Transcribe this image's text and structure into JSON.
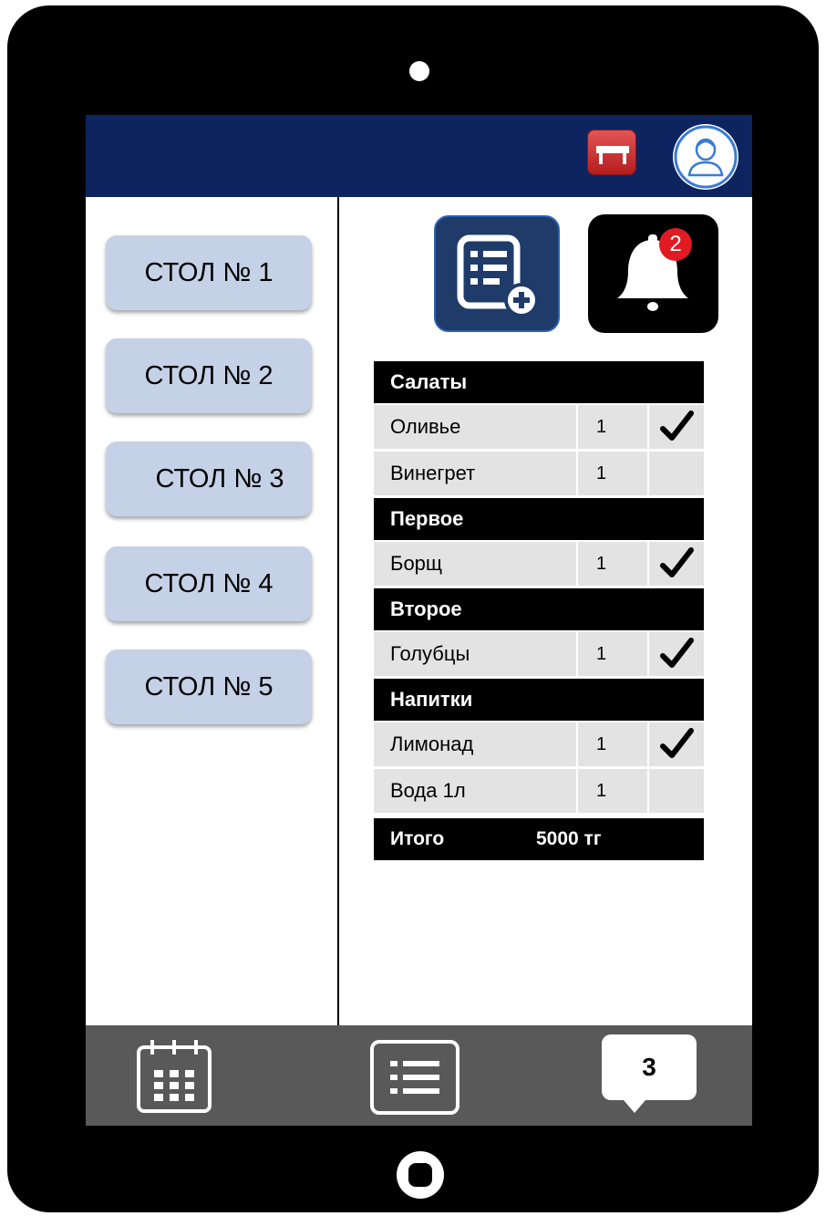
{
  "tables": [
    {
      "label": "СТОЛ № 1"
    },
    {
      "label": "СТОЛ № 2"
    },
    {
      "label": "СТОЛ № 3"
    },
    {
      "label": "СТОЛ № 4"
    },
    {
      "label": "СТОЛ № 5"
    }
  ],
  "notifications": {
    "count": "2"
  },
  "order": {
    "categories": [
      {
        "name": "Салаты",
        "items": [
          {
            "name": "Оливье",
            "qty": "1",
            "served": true
          },
          {
            "name": "Винегрет",
            "qty": "1",
            "served": false
          }
        ]
      },
      {
        "name": "Первое",
        "items": [
          {
            "name": "Борщ",
            "qty": "1",
            "served": true
          }
        ]
      },
      {
        "name": "Второе",
        "items": [
          {
            "name": "Голубцы",
            "qty": "1",
            "served": true
          }
        ]
      },
      {
        "name": "Напитки",
        "items": [
          {
            "name": "Лимонад",
            "qty": "1",
            "served": true
          },
          {
            "name": "Вода 1л",
            "qty": "1",
            "served": false
          }
        ]
      }
    ],
    "total_label": "Итого",
    "total_value": "5000 тг"
  },
  "bottom_nav": {
    "calendar_icon": "calendar-icon",
    "list_icon": "list-icon",
    "chat_count": "3"
  },
  "colors": {
    "header": "#0e2461",
    "table_button": "#c5d1e6",
    "bottom_bar": "#595959",
    "badge": "#e01b24"
  }
}
